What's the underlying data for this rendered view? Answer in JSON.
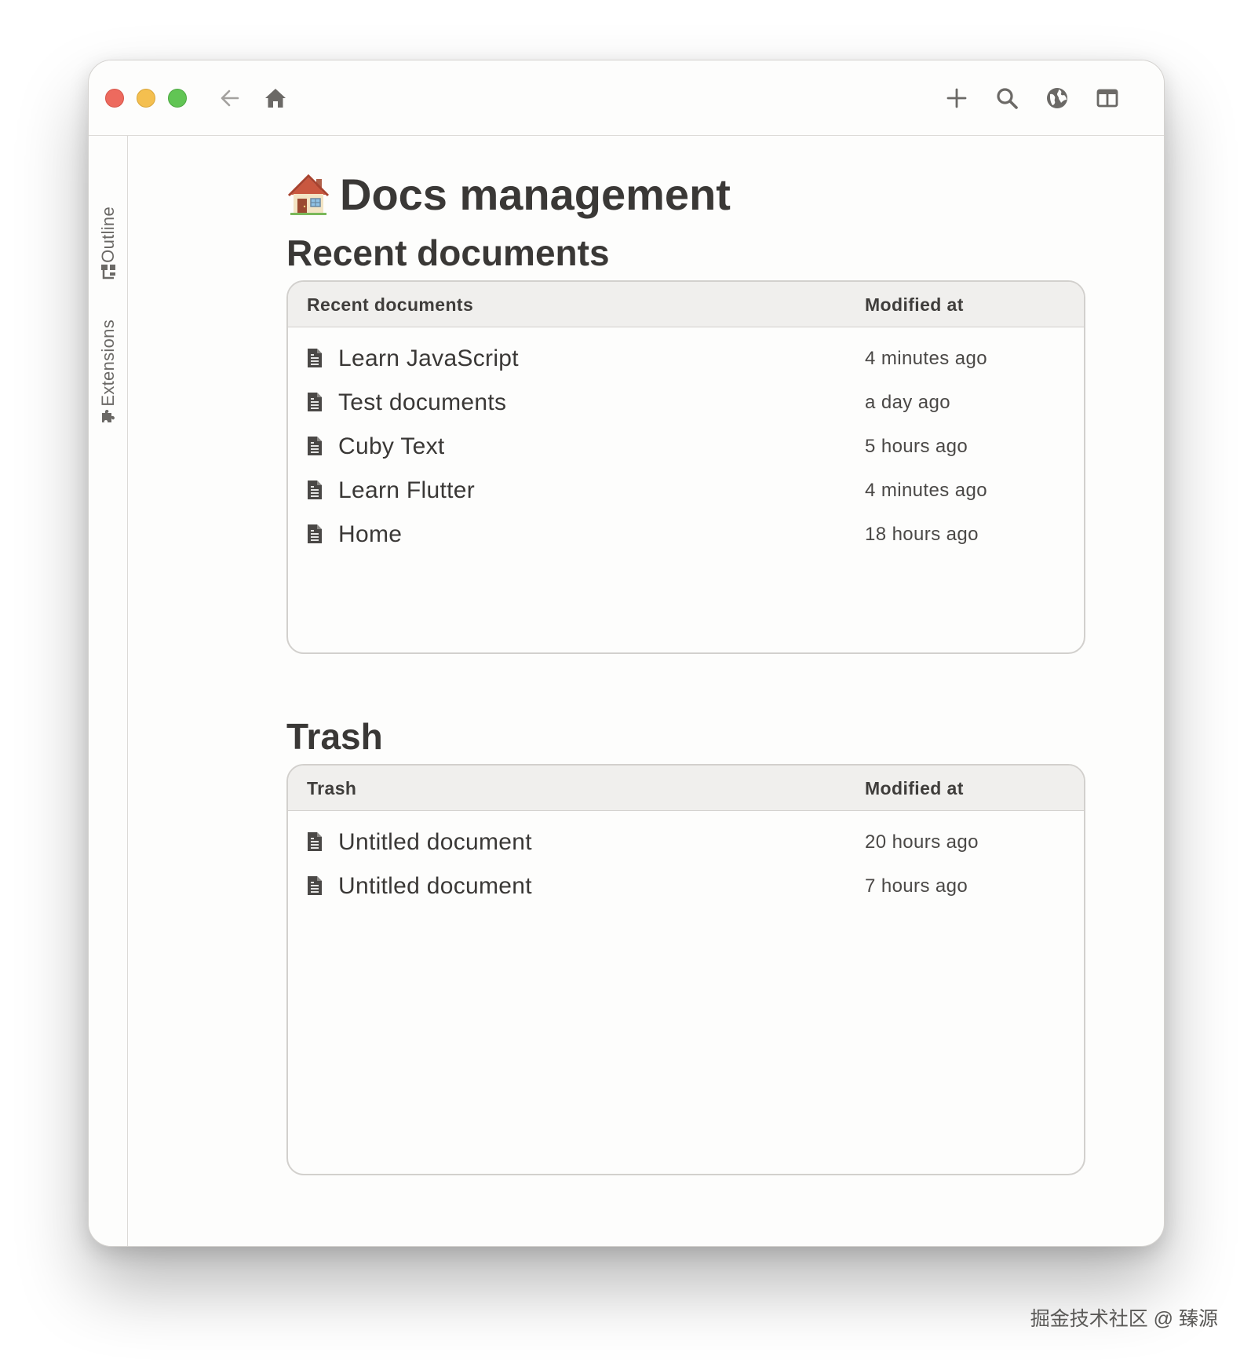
{
  "toolbar": {
    "back_icon": "arrow-left-icon",
    "home_icon": "home-icon",
    "add_icon": "plus-icon",
    "search_icon": "search-icon",
    "web_icon": "globe-icon",
    "layout_icon": "split-panel-icon"
  },
  "sidebar": {
    "tabs": [
      {
        "label": "Outline",
        "icon": "outline-tree-icon"
      },
      {
        "label": "Extensions",
        "icon": "puzzle-icon"
      }
    ]
  },
  "page": {
    "emoji": "house-emoji",
    "title": "Docs management"
  },
  "recent": {
    "section_title": "Recent documents",
    "columns": [
      "Recent documents",
      "Modified at"
    ],
    "rows": [
      {
        "name": "Learn JavaScript",
        "modified": "4 minutes ago"
      },
      {
        "name": "Test documents",
        "modified": "a day ago"
      },
      {
        "name": "Cuby Text",
        "modified": "5 hours ago"
      },
      {
        "name": "Learn Flutter",
        "modified": "4 minutes ago"
      },
      {
        "name": "Home",
        "modified": "18 hours ago"
      }
    ]
  },
  "trash": {
    "section_title": "Trash",
    "columns": [
      "Trash",
      "Modified at"
    ],
    "rows": [
      {
        "name": "Untitled document",
        "modified": "20 hours ago"
      },
      {
        "name": "Untitled document",
        "modified": "7 hours ago"
      }
    ]
  },
  "watermark": "掘金技术社区 @ 臻源"
}
